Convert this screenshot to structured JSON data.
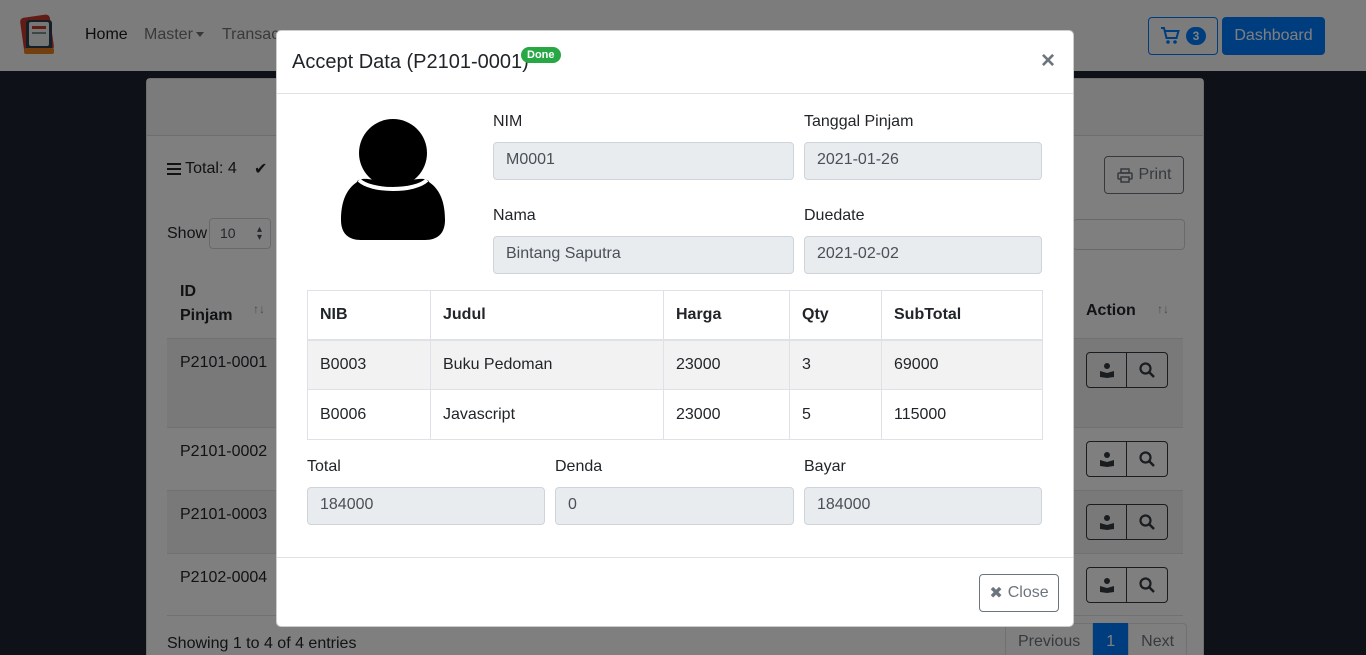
{
  "nav": {
    "home": "Home",
    "master": "Master",
    "transaction": "Transac",
    "cart_count": "3",
    "dashboard": "Dashboard"
  },
  "background": {
    "total_label": "Total: 4",
    "print": "Print",
    "show_label": "Show",
    "show_value": "10",
    "col_id": "ID Pinjam",
    "col_action": "Action",
    "rows": [
      {
        "id": "P2101-0001"
      },
      {
        "id": "P2101-0002"
      },
      {
        "id": "P2101-0003"
      },
      {
        "id": "P2102-0004"
      }
    ],
    "showing": "Showing 1 to 4 of 4 entries",
    "prev": "Previous",
    "page": "1",
    "next": "Next"
  },
  "modal": {
    "title": "Accept Data (P2101-0001)",
    "status": "Done",
    "nim_label": "NIM",
    "nim": "M0001",
    "tanggal_label": "Tanggal Pinjam",
    "tanggal": "2021-01-26",
    "nama_label": "Nama",
    "nama": "Bintang Saputra",
    "duedate_label": "Duedate",
    "duedate": "2021-02-02",
    "table": {
      "headers": [
        "NIB",
        "Judul",
        "Harga",
        "Qty",
        "SubTotal"
      ],
      "rows": [
        [
          "B0003",
          "Buku Pedoman",
          "23000",
          "3",
          "69000"
        ],
        [
          "B0006",
          "Javascript",
          "23000",
          "5",
          "115000"
        ]
      ]
    },
    "total_label": "Total",
    "total": "184000",
    "denda_label": "Denda",
    "denda": "0",
    "bayar_label": "Bayar",
    "bayar": "184000",
    "close": "Close"
  },
  "colors": {
    "primary": "#007bff",
    "success": "#28a745",
    "secondary": "#6c757d"
  }
}
